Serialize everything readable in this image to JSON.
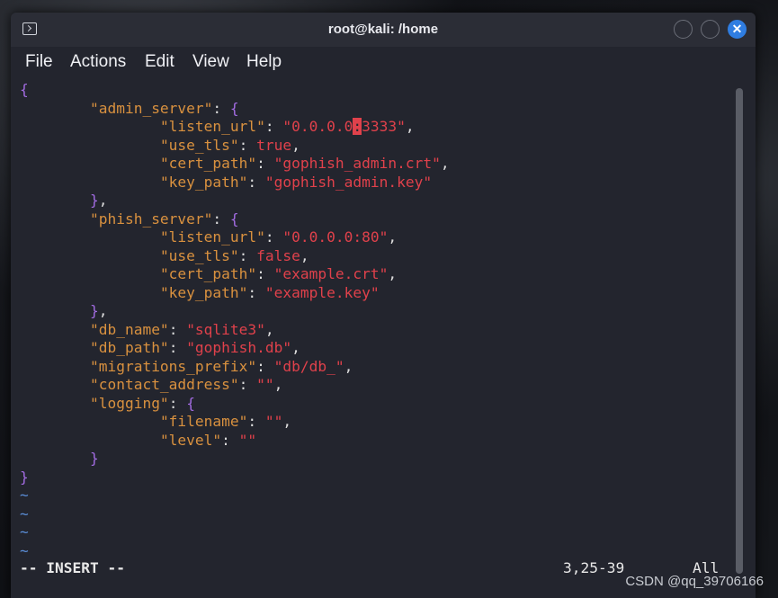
{
  "window": {
    "title": "root@kali: /home",
    "close_glyph": "✕"
  },
  "menu": [
    "File",
    "Actions",
    "Edit",
    "View",
    "Help"
  ],
  "editor": {
    "lines": [
      [
        {
          "c": "p",
          "t": "{"
        }
      ],
      [
        {
          "c": "w",
          "t": "        "
        },
        {
          "c": "k",
          "t": "\"admin_server\""
        },
        {
          "c": "w",
          "t": ": "
        },
        {
          "c": "p",
          "t": "{"
        }
      ],
      [
        {
          "c": "w",
          "t": "                "
        },
        {
          "c": "k",
          "t": "\"listen_url\""
        },
        {
          "c": "w",
          "t": ": "
        },
        {
          "c": "s",
          "t": "\"0.0.0.0"
        },
        {
          "c": "cursor",
          "t": ":"
        },
        {
          "c": "s",
          "t": "3333\""
        },
        {
          "c": "w",
          "t": ","
        }
      ],
      [
        {
          "c": "w",
          "t": "                "
        },
        {
          "c": "k",
          "t": "\"use_tls\""
        },
        {
          "c": "w",
          "t": ": "
        },
        {
          "c": "s",
          "t": "true"
        },
        {
          "c": "w",
          "t": ","
        }
      ],
      [
        {
          "c": "w",
          "t": "                "
        },
        {
          "c": "k",
          "t": "\"cert_path\""
        },
        {
          "c": "w",
          "t": ": "
        },
        {
          "c": "s",
          "t": "\"gophish_admin.crt\""
        },
        {
          "c": "w",
          "t": ","
        }
      ],
      [
        {
          "c": "w",
          "t": "                "
        },
        {
          "c": "k",
          "t": "\"key_path\""
        },
        {
          "c": "w",
          "t": ": "
        },
        {
          "c": "s",
          "t": "\"gophish_admin.key\""
        }
      ],
      [
        {
          "c": "w",
          "t": "        "
        },
        {
          "c": "p",
          "t": "}"
        },
        {
          "c": "w",
          "t": ","
        }
      ],
      [
        {
          "c": "w",
          "t": "        "
        },
        {
          "c": "k",
          "t": "\"phish_server\""
        },
        {
          "c": "w",
          "t": ": "
        },
        {
          "c": "p",
          "t": "{"
        }
      ],
      [
        {
          "c": "w",
          "t": "                "
        },
        {
          "c": "k",
          "t": "\"listen_url\""
        },
        {
          "c": "w",
          "t": ": "
        },
        {
          "c": "s",
          "t": "\"0.0.0.0:80\""
        },
        {
          "c": "w",
          "t": ","
        }
      ],
      [
        {
          "c": "w",
          "t": "                "
        },
        {
          "c": "k",
          "t": "\"use_tls\""
        },
        {
          "c": "w",
          "t": ": "
        },
        {
          "c": "s",
          "t": "false"
        },
        {
          "c": "w",
          "t": ","
        }
      ],
      [
        {
          "c": "w",
          "t": "                "
        },
        {
          "c": "k",
          "t": "\"cert_path\""
        },
        {
          "c": "w",
          "t": ": "
        },
        {
          "c": "s",
          "t": "\"example.crt\""
        },
        {
          "c": "w",
          "t": ","
        }
      ],
      [
        {
          "c": "w",
          "t": "                "
        },
        {
          "c": "k",
          "t": "\"key_path\""
        },
        {
          "c": "w",
          "t": ": "
        },
        {
          "c": "s",
          "t": "\"example.key\""
        }
      ],
      [
        {
          "c": "w",
          "t": "        "
        },
        {
          "c": "p",
          "t": "}"
        },
        {
          "c": "w",
          "t": ","
        }
      ],
      [
        {
          "c": "w",
          "t": "        "
        },
        {
          "c": "k",
          "t": "\"db_name\""
        },
        {
          "c": "w",
          "t": ": "
        },
        {
          "c": "s",
          "t": "\"sqlite3\""
        },
        {
          "c": "w",
          "t": ","
        }
      ],
      [
        {
          "c": "w",
          "t": "        "
        },
        {
          "c": "k",
          "t": "\"db_path\""
        },
        {
          "c": "w",
          "t": ": "
        },
        {
          "c": "s",
          "t": "\"gophish.db\""
        },
        {
          "c": "w",
          "t": ","
        }
      ],
      [
        {
          "c": "w",
          "t": "        "
        },
        {
          "c": "k",
          "t": "\"migrations_prefix\""
        },
        {
          "c": "w",
          "t": ": "
        },
        {
          "c": "s",
          "t": "\"db/db_\""
        },
        {
          "c": "w",
          "t": ","
        }
      ],
      [
        {
          "c": "w",
          "t": "        "
        },
        {
          "c": "k",
          "t": "\"contact_address\""
        },
        {
          "c": "w",
          "t": ": "
        },
        {
          "c": "s",
          "t": "\"\""
        },
        {
          "c": "w",
          "t": ","
        }
      ],
      [
        {
          "c": "w",
          "t": "        "
        },
        {
          "c": "k",
          "t": "\"logging\""
        },
        {
          "c": "w",
          "t": ": "
        },
        {
          "c": "p",
          "t": "{"
        }
      ],
      [
        {
          "c": "w",
          "t": "                "
        },
        {
          "c": "k",
          "t": "\"filename\""
        },
        {
          "c": "w",
          "t": ": "
        },
        {
          "c": "s",
          "t": "\"\""
        },
        {
          "c": "w",
          "t": ","
        }
      ],
      [
        {
          "c": "w",
          "t": "                "
        },
        {
          "c": "k",
          "t": "\"level\""
        },
        {
          "c": "w",
          "t": ": "
        },
        {
          "c": "s",
          "t": "\"\""
        }
      ],
      [
        {
          "c": "w",
          "t": "        "
        },
        {
          "c": "p",
          "t": "}"
        }
      ],
      [
        {
          "c": "p",
          "t": "}"
        }
      ],
      [
        {
          "c": "t",
          "t": "~"
        }
      ],
      [
        {
          "c": "t",
          "t": "~"
        }
      ],
      [
        {
          "c": "t",
          "t": "~"
        }
      ],
      [
        {
          "c": "t",
          "t": "~"
        }
      ]
    ]
  },
  "status": {
    "mode": "-- INSERT --",
    "position": "3,25-39",
    "scroll": "All"
  },
  "watermark": "CSDN @qq_39706166"
}
